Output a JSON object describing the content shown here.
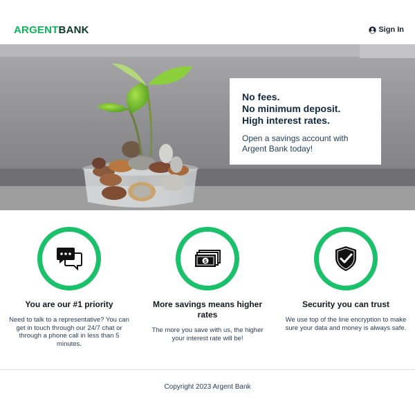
{
  "brand": {
    "part1": "ARGENT",
    "part2": "BANK",
    "color_primary": "#12b35c",
    "color_dark": "#0b3a26"
  },
  "header": {
    "signin_label": "Sign In",
    "signin_icon": "user-circle-icon"
  },
  "hero": {
    "image": "plant-growing-from-coins-in-glass-jar",
    "headline_lines": [
      "No fees.",
      "No minimum deposit.",
      "High interest rates."
    ],
    "subtext": "Open a savings account with Argent Bank today!"
  },
  "features": [
    {
      "icon": "chat-bubbles-icon",
      "title": "You are our #1 priority",
      "text": "Need to talk to a representative? You can get in touch through our 24/7 chat or through a phone call in less than 5 minutes."
    },
    {
      "icon": "money-bills-icon",
      "title": "More savings means higher rates",
      "text": "The more you save with us, the higher your interest rate will be!"
    },
    {
      "icon": "shield-check-icon",
      "title": "Security you can trust",
      "text": "We use top of the line encryption to make sure your data and money is always safe."
    }
  ],
  "accent_color": "#1bc06a",
  "footer": {
    "copyright": "Copyright 2023 Argent Bank"
  }
}
